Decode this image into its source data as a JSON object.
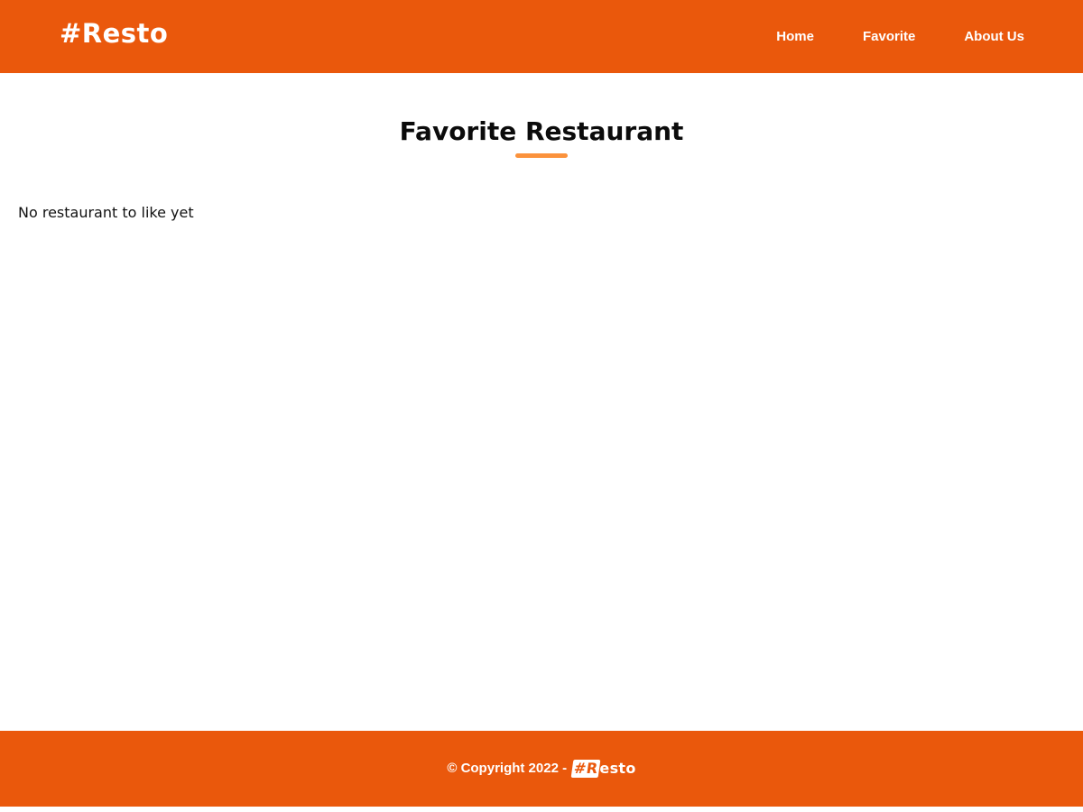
{
  "header": {
    "brand": "#Resto",
    "nav": [
      {
        "label": "Home"
      },
      {
        "label": "Favorite"
      },
      {
        "label": "About Us"
      }
    ]
  },
  "main": {
    "title": "Favorite Restaurant",
    "empty_message": "No restaurant to like yet"
  },
  "footer": {
    "copyright": "© Copyright 2022 -",
    "brand_mark": "#R",
    "brand_rest": "esto"
  },
  "colors": {
    "brand": "#ea580c",
    "accent_underline": "#fb923c",
    "text": "#111111",
    "background": "#ffffff"
  }
}
